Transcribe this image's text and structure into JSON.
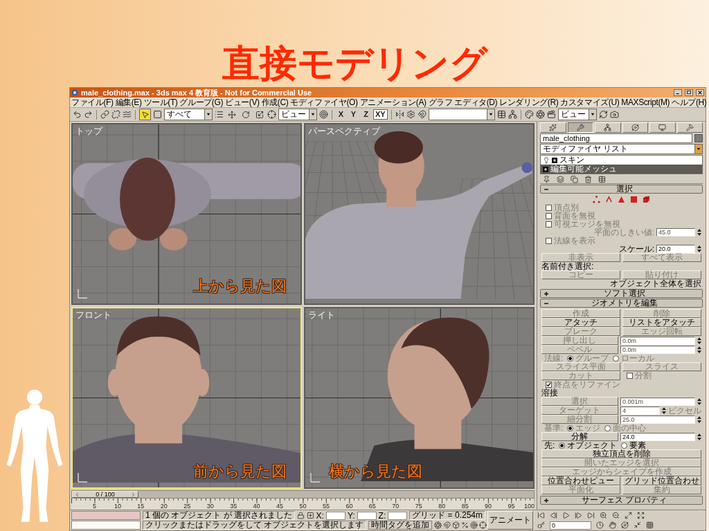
{
  "slide": {
    "title": "直接モデリング"
  },
  "window": {
    "title": "male_clothing.max - 3ds max 4 教育版 - Not for Commercial Use"
  },
  "menu": [
    "ファイル(F)",
    "編集(E)",
    "ツール(T)",
    "グループ(G)",
    "ビュー(V)",
    "作成(C)",
    "モディファイヤ(O)",
    "アニメーション(A)",
    "グラフ エディタ(D)",
    "レンダリング(R)",
    "カスタマイズ(U)",
    "MAXScript(M)",
    "ヘルプ(H)"
  ],
  "toolbar": {
    "tools": [
      {
        "selected": true
      },
      {
        "selected": false
      },
      {
        "selected": false
      },
      {
        "selected": false
      }
    ],
    "selection_filter": "すべて",
    "coordinate_system": "ビュー",
    "axes": [
      {
        "label": "X",
        "selected": false
      },
      {
        "label": "Y",
        "selected": false
      },
      {
        "label": "Z",
        "selected": false
      },
      {
        "label": "XY",
        "selected": true
      }
    ],
    "render_type": "ビュー"
  },
  "viewports": [
    {
      "label": "トップ",
      "kind": "top",
      "active": false,
      "caption": "上から見た図"
    },
    {
      "label": "パースペクティブ",
      "kind": "perspective",
      "active": false
    },
    {
      "label": "フロント",
      "kind": "front",
      "active": true,
      "caption": "前から見た図"
    },
    {
      "label": "ライト",
      "kind": "side",
      "active": false,
      "caption": "横から見た図"
    }
  ],
  "command_panel": {
    "tabs": [
      {
        "selected": false
      },
      {
        "selected": true
      },
      {
        "selected": false
      },
      {
        "selected": false
      },
      {
        "selected": false
      },
      {
        "selected": false
      }
    ],
    "object_name": "male_clothing",
    "modifier_list": "モディファイヤ リスト",
    "stack": [
      {
        "label": "スキン",
        "kind": "modifier",
        "selected": false
      },
      {
        "label": "編集可能メッシュ",
        "kind": "base",
        "selected": true
      }
    ],
    "rollouts": [
      {
        "title": "選択",
        "expanded": true,
        "rows": [
          {
            "kind": "subobjects"
          },
          {
            "kind": "checkbox",
            "label": "頂点別",
            "checked": false,
            "disabled": true
          },
          {
            "kind": "checkbox",
            "label": "背面を無視",
            "checked": false,
            "disabled": true
          },
          {
            "kind": "checkbox",
            "label": "可視エッジを無視",
            "checked": false,
            "disabled": true
          },
          {
            "kind": "spinner",
            "label": "平面のしきい値:",
            "value": "45.0",
            "disabled": true
          },
          {
            "kind": "checkbox",
            "label": "法線を表示",
            "checked": false,
            "disabled": true
          },
          {
            "kind": "spinner",
            "label": "スケール:",
            "value": "20.0",
            "disabled": false
          },
          {
            "kind": "buttons",
            "buttons": [
              {
                "label": "非表示",
                "disabled": true
              },
              {
                "label": "すべて表示",
                "disabled": true
              }
            ]
          },
          {
            "kind": "text",
            "label": "名前付き選択:"
          },
          {
            "kind": "buttons",
            "buttons": [
              {
                "label": "コピー",
                "disabled": true
              },
              {
                "label": "貼り付け",
                "disabled": true
              }
            ]
          },
          {
            "kind": "note",
            "label": "オブジェクト全体を選択"
          }
        ]
      },
      {
        "title": "ソフト選択",
        "expanded": false
      },
      {
        "title": "ジオメトリを編集",
        "expanded": true,
        "rows": [
          {
            "kind": "buttons",
            "buttons": [
              {
                "label": "作成",
                "disabled": true
              },
              {
                "label": "削除",
                "disabled": true
              }
            ]
          },
          {
            "kind": "buttons",
            "buttons": [
              {
                "label": "アタッチ",
                "disabled": false
              },
              {
                "label": "リストをアタッチ",
                "disabled": false
              }
            ]
          },
          {
            "kind": "buttons",
            "buttons": [
              {
                "label": "ブレーク",
                "disabled": true
              },
              {
                "label": "エッジ回転",
                "disabled": true
              }
            ]
          },
          {
            "kind": "button_spinner",
            "label": "押し出し",
            "value": "0.0m",
            "disabled": true
          },
          {
            "kind": "button_spinner",
            "label": "ベベル",
            "value": "0.0m",
            "disabled": true
          },
          {
            "kind": "radio",
            "label": "法線:",
            "options": [
              {
                "label": "グループ",
                "selected": true
              },
              {
                "label": "ローカル",
                "selected": false
              }
            ],
            "disabled": true
          },
          {
            "kind": "buttons",
            "buttons": [
              {
                "label": "スライス平面",
                "disabled": true
              },
              {
                "label": "スライス",
                "disabled": true
              }
            ]
          },
          {
            "kind": "button_check",
            "label": "カット",
            "check_label": "分割",
            "checked": false,
            "disabled": true
          },
          {
            "kind": "checkbox",
            "label": "終点をリファイン",
            "checked": true,
            "disabled": true
          },
          {
            "kind": "text",
            "label": "溶接"
          },
          {
            "kind": "button_spinner",
            "label": "選択",
            "value": "0.001m",
            "disabled": true
          },
          {
            "kind": "button_spinner",
            "label": "ターゲット",
            "value": "4",
            "unit": "ピクセル",
            "disabled": true
          },
          {
            "kind": "button_spinner",
            "label": "細分割",
            "value": "25.0",
            "disabled": true
          },
          {
            "kind": "radio",
            "label": "基準:",
            "options": [
              {
                "label": "エッジ",
                "selected": true
              },
              {
                "label": "面の中心",
                "selected": false
              }
            ],
            "disabled": true
          },
          {
            "kind": "button_spinner",
            "label": "分解",
            "value": "24.0",
            "disabled": false
          },
          {
            "kind": "radio",
            "label": "先:",
            "options": [
              {
                "label": "オブジェクト",
                "selected": true
              },
              {
                "label": "要素",
                "selected": false
              }
            ],
            "disabled": false
          },
          {
            "kind": "buttons",
            "buttons": [
              {
                "label": "独立頂点を削除",
                "disabled": false
              }
            ]
          },
          {
            "kind": "buttons",
            "buttons": [
              {
                "label": "開いたエッジを選択",
                "disabled": true
              }
            ]
          },
          {
            "kind": "buttons",
            "buttons": [
              {
                "label": "エッジからシェイプを作成",
                "disabled": true
              }
            ]
          },
          {
            "kind": "buttons",
            "buttons": [
              {
                "label": "位置合わせビュー",
                "disabled": false
              },
              {
                "label": "グリッド位置合わせ",
                "disabled": false
              }
            ]
          },
          {
            "kind": "buttons",
            "buttons": [
              {
                "label": "平面化",
                "disabled": true
              },
              {
                "label": "集約",
                "disabled": true
              }
            ]
          }
        ]
      },
      {
        "title": "サーフェス プロパティ",
        "expanded": false
      }
    ]
  },
  "timeline": {
    "slider": {
      "label": "0 / 100",
      "level": 0
    },
    "ticks": [
      "5",
      "10",
      "15",
      "20",
      "25",
      "30",
      "35",
      "40",
      "45",
      "50",
      "55",
      "60",
      "65",
      "70",
      "75",
      "80",
      "85",
      "90",
      "95",
      "100"
    ]
  },
  "status": {
    "prompt": "1 個の オブジェクト が 選択されました",
    "hint": "クリックまたはドラッグをして オブジェクトを選択します",
    "coordinates": [
      "X:",
      "Y:",
      "Z:"
    ],
    "grid": "グリッド = 0.254m",
    "time_tag": "時間タグを追加",
    "animate": "アニメート",
    "frame": "0"
  }
}
